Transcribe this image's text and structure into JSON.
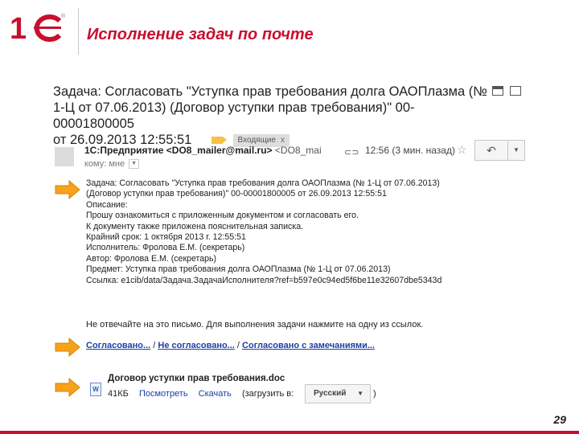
{
  "slide": {
    "logo_text": "1С",
    "title": "Исполнение задач по почте",
    "page_number": "29",
    "brand_color": "#c8102e"
  },
  "email": {
    "subject_line1": "Задача: Согласовать \"Уступка прав требования долга ОАОПлазма (№",
    "subject_line2": "1-Ц от 07.06.2013) (Договор уступки прав требования)\" 00-00001800005",
    "subject_line3": "от 26.09.2013 12:55:51",
    "label": "Входящие",
    "label_close": "x",
    "sender_name": "1С:Предприятие <DO8_mailer@mail.ru>",
    "sender_addr": "<DO8_mai",
    "time": "12:56 (3 мин. назад)",
    "to_label": "кому: мне",
    "icons": [
      "print-icon",
      "new-window-icon",
      "star-icon",
      "reply-icon",
      "more-icon",
      "doc-icon"
    ],
    "body_lines": [
      "Задача: Согласовать \"Уступка прав требования долга ОАОПлазма (№ 1-Ц от 07.06.2013)",
      "(Договор уступки прав требования)\" 00-00001800005 от 26.09.2013 12:55:51",
      "Описание:",
      "Прошу ознакомиться с приложенным документом и согласовать его.",
      "К документу также приложена пояснительная записка.",
      "Крайний срок: 1 октября 2013 г. 12:55:51",
      "Исполнитель: Фролова Е.М. (секретарь)",
      "Автор: Фролова Е.М. (секретарь)",
      "Предмет: Уступка прав требования долга ОАОПлазма (№ 1-Ц от 07.06.2013)",
      "Ссылка: e1cib/data/Задача.ЗадачаИсполнителя?ref=b597e0c94ed5f6be11e32607dbe5343d"
    ],
    "footer_note": "Не отвечайте на это письмо. Для выполнения задачи нажмите на одну из ссылок.",
    "links": {
      "approved": "Согласовано...",
      "sep": "/",
      "not_approved": "Не согласовано...",
      "approved_with_remarks": "Согласовано с замечаниями..."
    },
    "attachment": {
      "name": "Договор уступки прав требования.doc",
      "size": "41КБ",
      "view": "Посмотреть",
      "download": "Скачать",
      "upload_to": "(загрузить в:",
      "language": "Русский",
      "close_paren": ")"
    }
  }
}
